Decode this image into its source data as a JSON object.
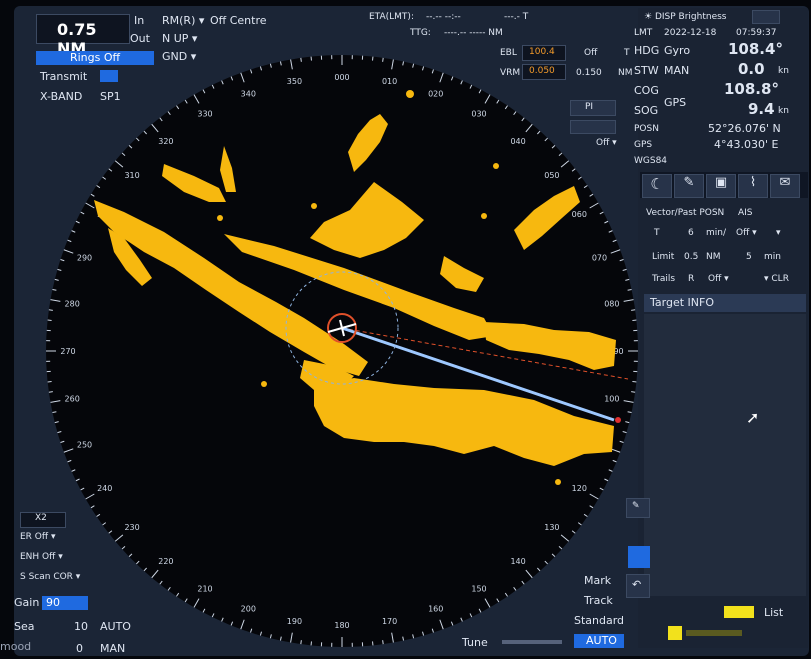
{
  "top_left": {
    "range": "0.75 NM",
    "in_label": "In",
    "out_label": "Out",
    "rings": "Rings Off",
    "motion": "RM(R)",
    "centre": "Off Centre",
    "orientation": "N UP",
    "stab": "GND",
    "transmit": "Transmit",
    "band": "X-BAND",
    "pulse": "SP1"
  },
  "top_center": {
    "eta_label": "ETA(LMT):",
    "eta_value": "--.-- --:--",
    "ttg_label": "TTG:",
    "ttg_value": "----.-- ----- NM",
    "wpt_value": "---.- T",
    "ebl_label": "EBL",
    "ebl_value": "100.4",
    "ebl_off": "Off",
    "ebl_t": "T",
    "vrm_label": "VRM",
    "vrm_value": "0.050",
    "vrm_right": "0.150",
    "vrm_unit": "NM",
    "pi_label": "PI",
    "off_label": "Off"
  },
  "right_panel": {
    "disp_brightness": "DISP Brightness",
    "lmt_label": "LMT",
    "date": "2022-12-18",
    "time": "07:59:37",
    "hdg_label": "HDG",
    "hdg_src": "Gyro",
    "hdg_value": "108.4",
    "stw_label": "STW",
    "stw_src": "MAN",
    "stw_value": "0.0",
    "stw_unit": "kn",
    "cog_label": "COG",
    "cog_value": "108.8",
    "sog_label": "SOG",
    "sog_src": "GPS",
    "sog_value": "9.4",
    "sog_unit": "kn",
    "posn_label": "POSN",
    "lat": "52°26.076' N",
    "posn_src": "GPS",
    "lon": "4°43.030' E",
    "datum": "WGS84",
    "vector_label": "Vector/Past POSN",
    "ais_label": "AIS",
    "vec_mode": "T",
    "vec_time": "6",
    "vec_unit": "min/",
    "vec_off": "Off",
    "limit_label": "Limit",
    "limit_value": "0.5",
    "limit_unit": "NM",
    "limit_min": "5",
    "limit_min_unit": "min",
    "trails_label": "Trails",
    "trails_mode": "R",
    "trails_off": "Off",
    "clr_label": "CLR",
    "target_info": "Target INFO",
    "list_label": "List"
  },
  "bottom_left": {
    "x2": "X2",
    "er": "ER Off",
    "enh": "ENH Off",
    "scan": "S Scan COR",
    "gain_label": "Gain",
    "gain_value": "90",
    "sea_label": "Sea",
    "sea_value": "10",
    "sea_mode": "AUTO",
    "rain_value": "0",
    "rain_mode": "MAN"
  },
  "bottom_right": {
    "mark": "Mark",
    "track": "Track",
    "standard": "Standard",
    "tune": "Tune",
    "tune_mode": "AUTO"
  },
  "bearings": [
    "000",
    "010",
    "020",
    "030",
    "040",
    "050",
    "060",
    "070",
    "080",
    "090",
    "100",
    "110",
    "120",
    "130",
    "140",
    "150",
    "160",
    "170",
    "180",
    "190",
    "200",
    "210",
    "220",
    "230",
    "240",
    "250",
    "260",
    "270",
    "280",
    "290",
    "300",
    "310",
    "320",
    "330",
    "340",
    "350"
  ],
  "watermark": "mood",
  "colors": {
    "echo": "#f7b80f",
    "screen": "#1b2536",
    "accent": "#1f6ae0",
    "heading": "#9ec8ff"
  }
}
